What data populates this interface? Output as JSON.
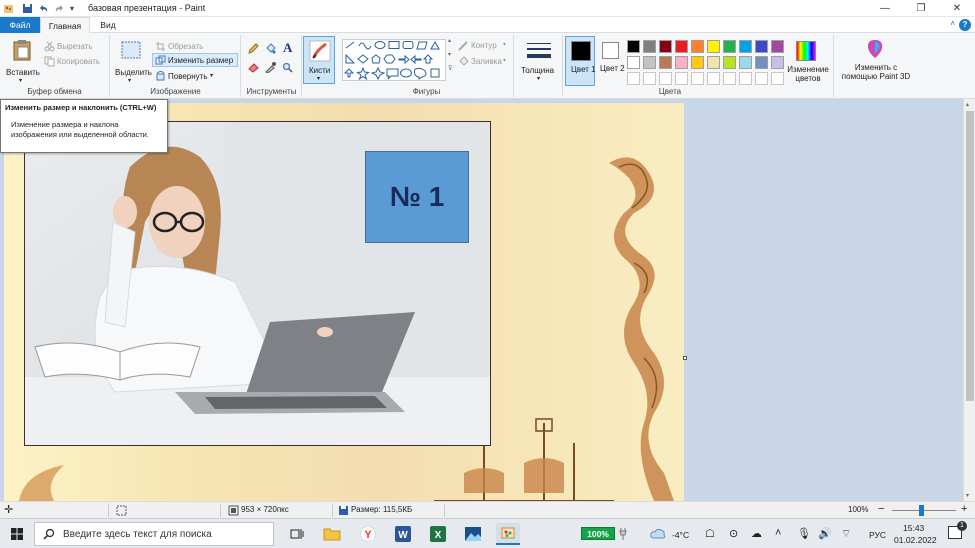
{
  "window": {
    "title": "базовая презентация - Paint",
    "minimize": "—",
    "restore": "❐",
    "close": "✕"
  },
  "tabs": [
    {
      "label": "Файл"
    },
    {
      "label": "Главная"
    },
    {
      "label": "Вид"
    }
  ],
  "ribbon": {
    "clipboard": {
      "label": "Буфер обмена",
      "paste": "Вставить",
      "cut": "Вырезать",
      "copy": "Копировать"
    },
    "image": {
      "label": "Изображение",
      "select": "Выделить",
      "crop": "Обрезать",
      "resize": "Изменить размер",
      "rotate": "Повернуть"
    },
    "tools": {
      "label": "Инструменты"
    },
    "brushes": {
      "label": "Кисти"
    },
    "shapes": {
      "label": "Фигуры",
      "outline": "Контур",
      "fill": "Заливка"
    },
    "size": {
      "label": "Толщина"
    },
    "colors": {
      "label": "Цвета",
      "color1": "Цвет 1",
      "color2": "Цвет 2",
      "edit": "Изменение цветов",
      "paint3d": "Изменить с помощью Paint 3D",
      "palette_row1": [
        "#000000",
        "#7f7f7f",
        "#880015",
        "#ed1c24",
        "#ff7f27",
        "#fff200",
        "#22b14c",
        "#00a2e8",
        "#3f48cc",
        "#a349a4"
      ],
      "palette_row2": [
        "#ffffff",
        "#c3c3c3",
        "#b97a57",
        "#ffaec9",
        "#ffc90e",
        "#efe4b0",
        "#b5e61d",
        "#99d9ea",
        "#7092be",
        "#c8bfe7"
      ]
    }
  },
  "tooltip": {
    "title": "Изменить размер и наклонить (CTRL+W)",
    "description": "Изменение размера и наклона изображения или выделенной области."
  },
  "canvas": {
    "number_label": "№ 1"
  },
  "statusbar": {
    "dimensions": "953 × 720пкс",
    "size": "Размер: 115,5КБ",
    "zoom": "100%"
  },
  "taskbar": {
    "search_placeholder": "Введите здесь текст для поиска",
    "battery": "100%",
    "temperature": "-4°C",
    "language": "РУС",
    "time": "15:43",
    "date": "01.02.2022"
  }
}
